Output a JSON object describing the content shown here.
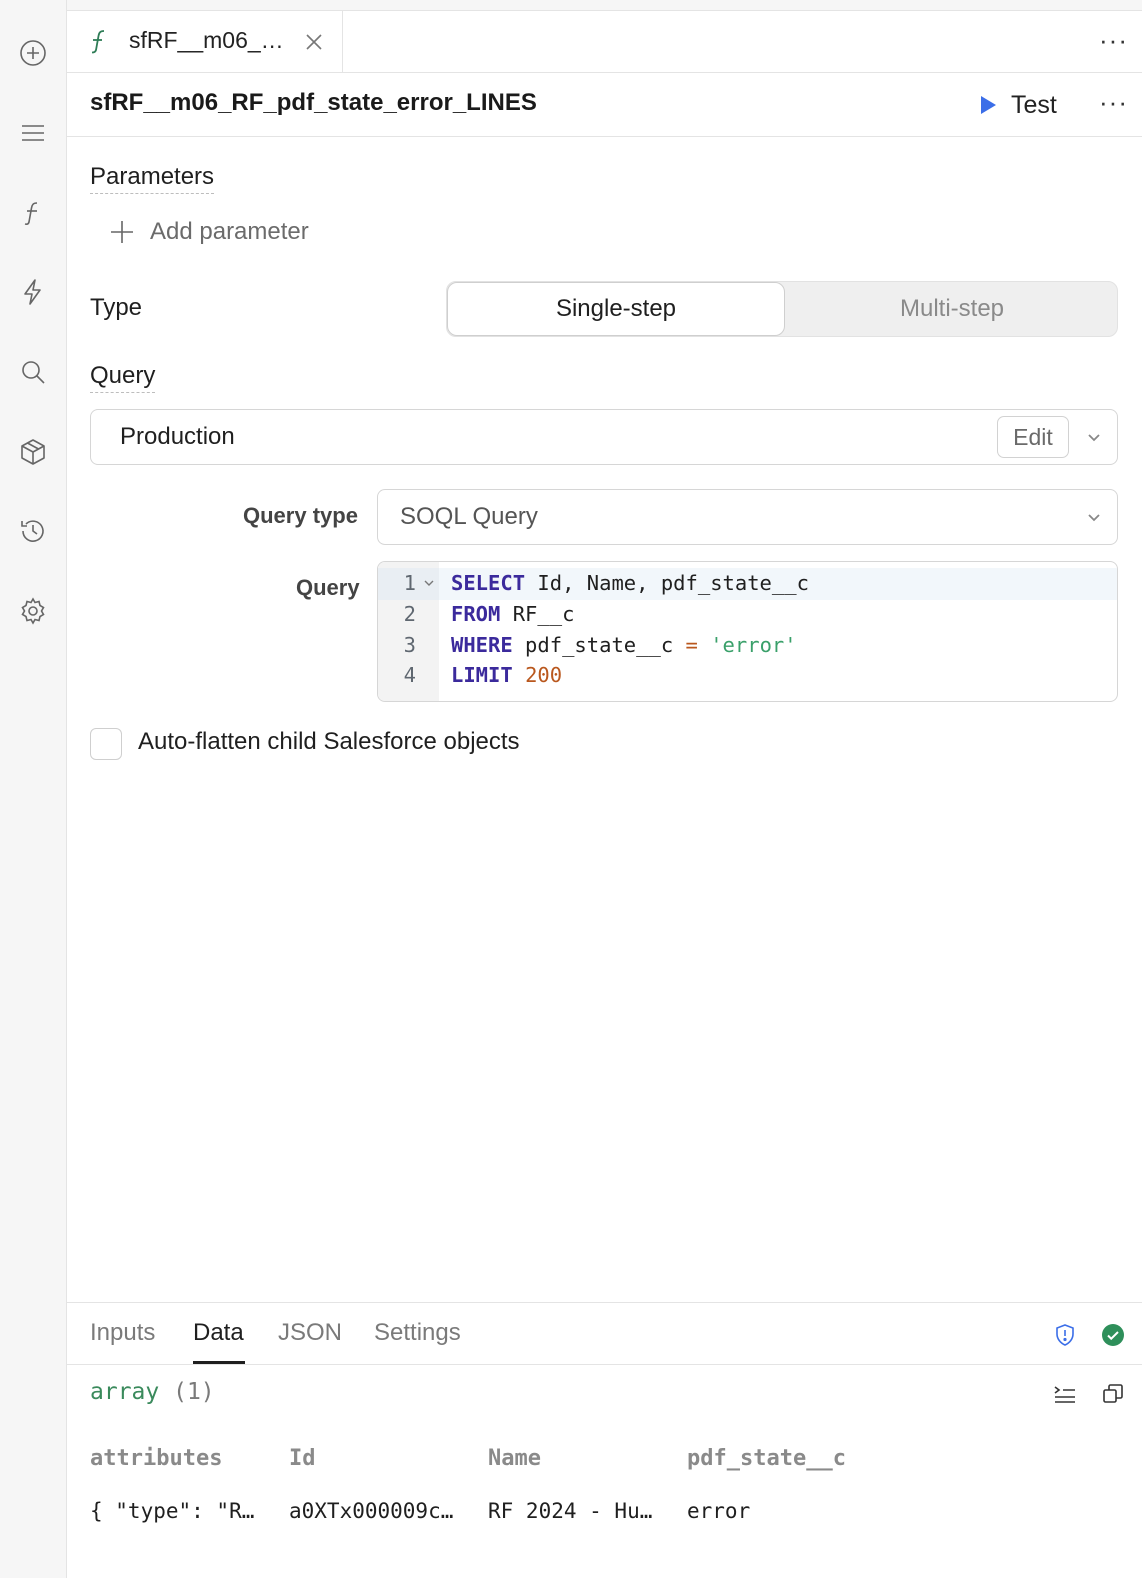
{
  "tab": {
    "label": "sfRF__m06_…"
  },
  "header": {
    "title": "sfRF__m06_RF_pdf_state_error_LINES",
    "test_label": "Test"
  },
  "parameters": {
    "label": "Parameters",
    "add_label": "Add parameter"
  },
  "type": {
    "label": "Type",
    "options": [
      "Single-step",
      "Multi-step"
    ],
    "selected": "Single-step"
  },
  "query": {
    "label": "Query",
    "resource": "Production",
    "edit_label": "Edit",
    "query_type_label": "Query type",
    "query_type_value": "SOQL Query",
    "editor_label": "Query",
    "line_numbers": [
      "1",
      "2",
      "3",
      "4"
    ],
    "lines": [
      {
        "kw": "SELECT",
        "rest": " Id, Name, pdf_state__c"
      },
      {
        "kw": "FROM",
        "rest": " RF__c"
      },
      {
        "kw": "WHERE",
        "rest": " pdf_state__c ",
        "op": "=",
        "str": "'error'"
      },
      {
        "kw": "LIMIT",
        "num": "200"
      }
    ]
  },
  "autoflatten": {
    "label": "Auto-flatten child Salesforce objects",
    "checked": false
  },
  "bottom": {
    "tabs": [
      "Inputs",
      "Data",
      "JSON",
      "Settings"
    ],
    "active_tab": "Data",
    "array_type": "array",
    "array_count": "(1)",
    "columns": [
      "attributes",
      "Id",
      "Name",
      "pdf_state__c"
    ],
    "rows": [
      [
        "{ \"type\": \"R…",
        "a0XTx000009c…",
        "RF 2024 - Hu…",
        "error"
      ]
    ]
  },
  "colors": {
    "accent_blue": "#3b6ee8",
    "success_green": "#2e8f5a",
    "fx_green": "#2f7d57"
  }
}
